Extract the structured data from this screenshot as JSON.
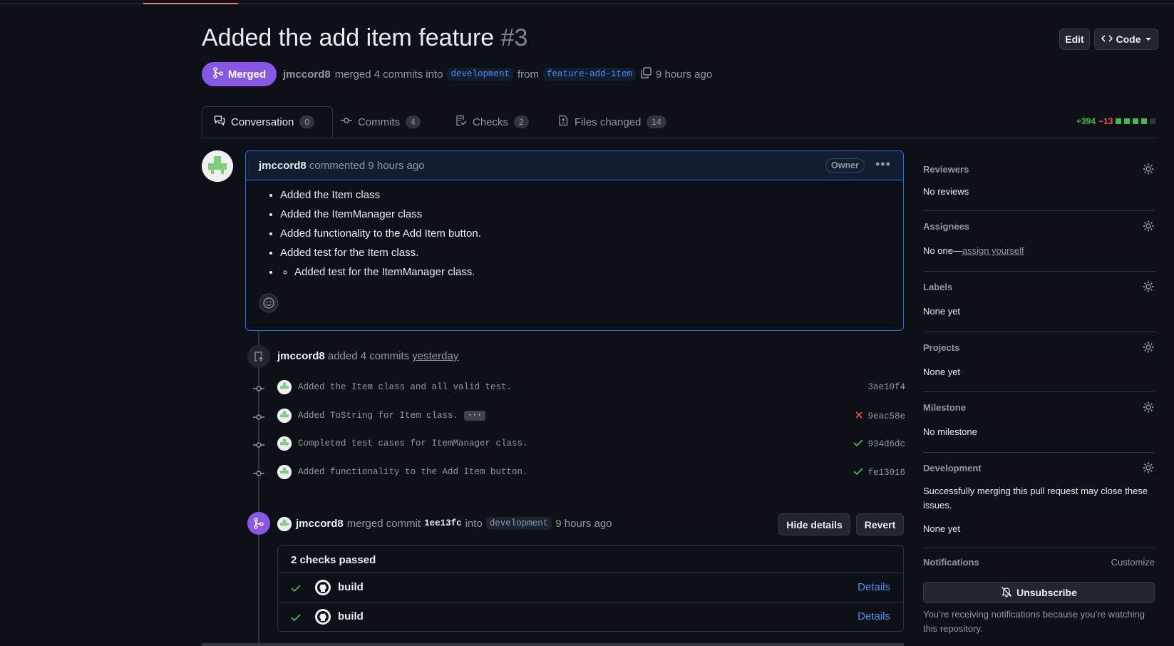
{
  "header": {
    "title": "Added the add item feature",
    "number": "#3",
    "edit_label": "Edit",
    "code_label": "Code",
    "status_label": "Merged",
    "author": "jmccord8",
    "merge_text": "merged 4 commits into",
    "base_branch": "development",
    "from_text": "from",
    "head_branch": "feature-add-item",
    "time": "9 hours ago"
  },
  "tabs": [
    {
      "label": "Conversation",
      "count": "0"
    },
    {
      "label": "Commits",
      "count": "4"
    },
    {
      "label": "Checks",
      "count": "2"
    },
    {
      "label": "Files changed",
      "count": "14"
    }
  ],
  "diffstat": {
    "additions": "+394",
    "deletions": "−13",
    "colors": {
      "add": "#3fb950",
      "del": "#f85149",
      "neutral": "#30363d"
    }
  },
  "comment": {
    "author": "jmccord8",
    "action": "commented 9 hours ago",
    "role_badge": "Owner",
    "bullets": [
      "Added the Item class",
      "Added the ItemManager class",
      "Added functionality to the Add Item button.",
      "Added test for the Item class."
    ],
    "nested_bullet": "Added test for the ItemManager class."
  },
  "commits_event": {
    "author": "jmccord8",
    "text": "added 4 commits",
    "when": "yesterday",
    "commits": [
      {
        "message": "Added the Item class and all valid test.",
        "sha": "3ae10f4",
        "status": ""
      },
      {
        "message": "Added ToString for Item class.",
        "sha": "9eac58e",
        "status": "fail"
      },
      {
        "message": "Completed test cases for ItemManager class.",
        "sha": "934d6dc",
        "status": "pass"
      },
      {
        "message": "Added functionality to the Add Item button.",
        "sha": "fe13016",
        "status": "pass"
      }
    ]
  },
  "merge_event": {
    "author": "jmccord8",
    "text": "merged commit",
    "sha": "1ee13fc",
    "into": "into",
    "branch": "development",
    "time": "9 hours ago",
    "hide_label": "Hide details",
    "revert_label": "Revert"
  },
  "checks": {
    "title": "2 checks passed",
    "items": [
      {
        "name": "build",
        "link": "Details"
      },
      {
        "name": "build",
        "link": "Details"
      }
    ]
  },
  "sidebar": {
    "reviewers": {
      "label": "Reviewers",
      "value": "No reviews"
    },
    "assignees": {
      "label": "Assignees",
      "value": "No one—",
      "link": "assign yourself"
    },
    "labels": {
      "label": "Labels",
      "value": "None yet"
    },
    "projects": {
      "label": "Projects",
      "value": "None yet"
    },
    "milestone": {
      "label": "Milestone",
      "value": "No milestone"
    },
    "development": {
      "label": "Development",
      "value": "Successfully merging this pull request may close these issues.",
      "value2": "None yet"
    },
    "notifications": {
      "label": "Notifications",
      "customize": "Customize",
      "unsubscribe": "Unsubscribe",
      "note": "You’re receiving notifications because you’re watching this repository."
    }
  }
}
